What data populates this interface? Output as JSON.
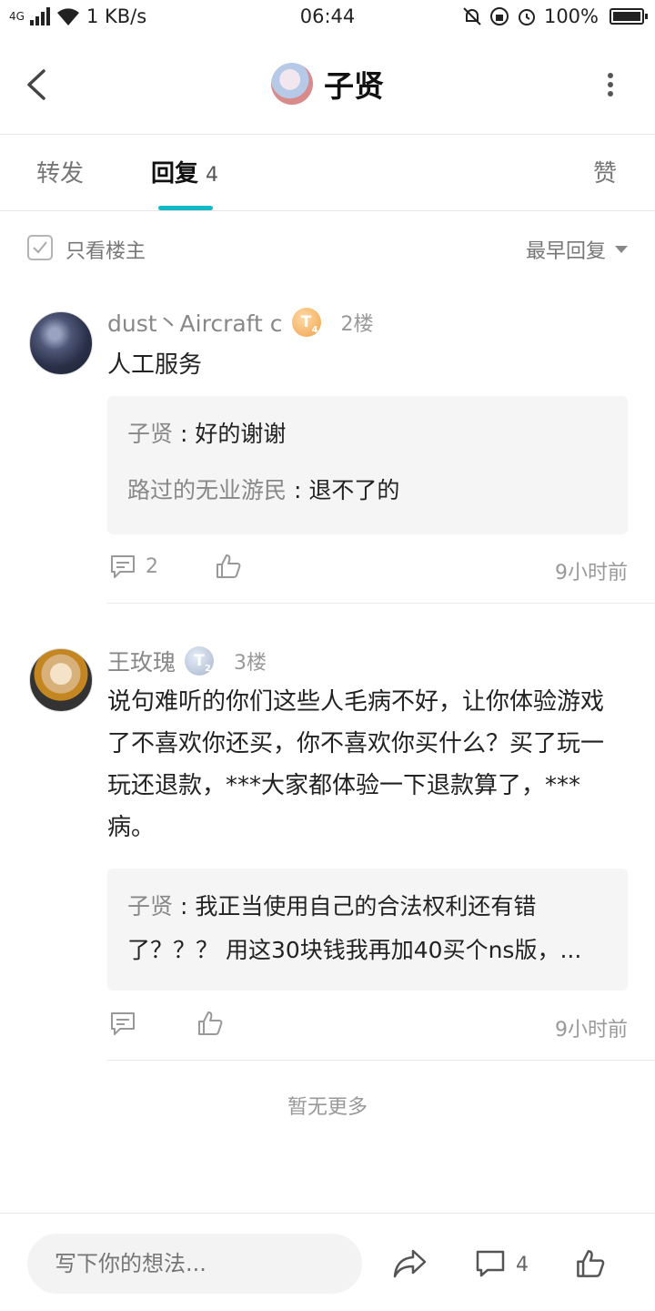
{
  "status_bar": {
    "network": "4G",
    "speed": "1 KB/s",
    "time": "06:44",
    "battery": "100%"
  },
  "header": {
    "title": "子贤"
  },
  "tabs": [
    {
      "label": "转发"
    },
    {
      "label": "回复",
      "count": "4"
    },
    {
      "label": "赞"
    }
  ],
  "filter": {
    "only_op_label": "只看楼主",
    "sort_label": "最早回复"
  },
  "posts": [
    {
      "author": "dust丶Aircraft c",
      "level": "T",
      "level_sub": "4",
      "floor": "2楼",
      "content": "人工服务",
      "replies": [
        {
          "name": "子贤",
          "text": "好的谢谢"
        },
        {
          "name": "路过的无业游民",
          "text": "退不了的"
        }
      ],
      "comment_count": "2",
      "time": "9小时前"
    },
    {
      "author": "王玫瑰",
      "level": "T",
      "level_sub": "2",
      "floor": "3楼",
      "content": "说句难听的你们这些人毛病不好，让你体验游戏了不喜欢你还买，你不喜欢你买什么？买了玩一玩还退款，***大家都体验一下退款算了，***病。",
      "replies": [
        {
          "name": "子贤",
          "text": "我正当使用自己的合法权利还有错了？？？ 用这30块钱我再加40买个ns版，..."
        }
      ],
      "comment_count": "",
      "time": "9小时前"
    }
  ],
  "no_more": "暂无更多",
  "bottom_bar": {
    "input_placeholder": "写下你的想法...",
    "comment_count": "4"
  },
  "colors": {
    "accent": "#14b9c8",
    "text_primary": "#222222",
    "text_secondary": "#888888",
    "quote_bg": "#f5f5f5"
  }
}
